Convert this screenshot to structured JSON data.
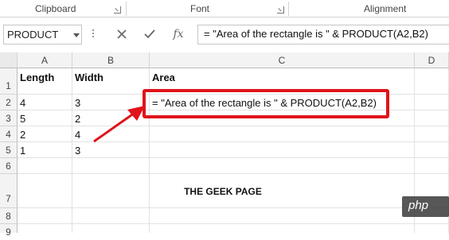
{
  "ribbon": {
    "groups": [
      "Clipboard",
      "Font",
      "Alignment"
    ]
  },
  "formula_bar": {
    "name_box": "PRODUCT",
    "cancel_icon": "close-icon",
    "enter_icon": "check-icon",
    "function_label": "fx",
    "formula": "= \"Area of the rectangle is \" & PRODUCT(A2,B2)"
  },
  "columns": [
    "A",
    "B",
    "C",
    "D"
  ],
  "rows": [
    "1",
    "2",
    "3",
    "4",
    "5",
    "6",
    "7",
    "8",
    "9"
  ],
  "cells": {
    "A1": "Length",
    "B1": "Width",
    "C1": "Area",
    "A2": "4",
    "B2": "3",
    "C2": "= \"Area of the rectangle is \" & PRODUCT(A2,B2)",
    "A3": "5",
    "B3": "2",
    "A4": "2",
    "B4": "4",
    "A5": "1",
    "B5": "3",
    "C7": "THE GEEK PAGE"
  },
  "watermark": "php",
  "colors": {
    "highlight": "#e0141c",
    "header_bg": "#f3f3f3",
    "gridline": "#e2e2e2"
  }
}
